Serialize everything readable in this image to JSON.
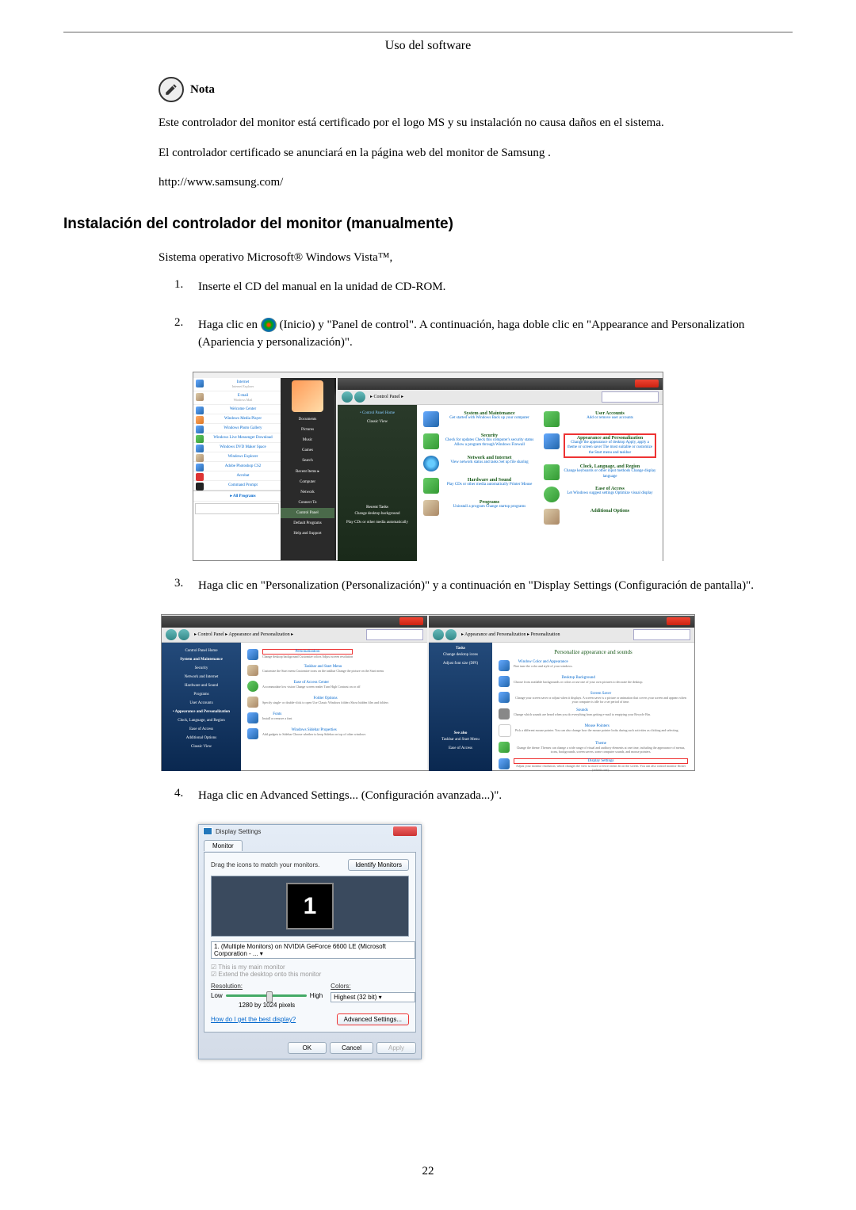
{
  "header": {
    "section_title": "Uso del software"
  },
  "note": {
    "label": "Nota",
    "line1": "Este controlador del monitor está certificado por el logo MS y su instalación no causa daños en el sistema.",
    "line2": "El controlador certificado se anunciará en la página web del monitor de Samsung .",
    "url": "http://www.samsung.com/"
  },
  "heading": "Instalación del controlador del monitor (manualmente)",
  "intro": "Sistema operativo Microsoft® Windows Vista™,",
  "steps": {
    "s1": {
      "num": "1.",
      "text": "Inserte el CD del manual en la unidad de CD-ROM."
    },
    "s2": {
      "num": "2.",
      "pre": "Haga clic en ",
      "mid": "(Inicio) y \"Panel de control\". A continuación, haga doble clic en \"Appearance and Personalization (Apariencia y personalización)\"."
    },
    "s3": {
      "num": "3.",
      "text": "Haga clic en \"Personalization (Personalización)\" y a continuación en \"Display Settings (Configuración de pantalla)\"."
    },
    "s4": {
      "num": "4.",
      "text": "Haga clic en Advanced Settings... (Configuración avanzada...)\"."
    }
  },
  "start_menu": {
    "items": [
      "Internet",
      "E-mail",
      "Welcome Center",
      "Windows Media Player",
      "Windows Photo Gallery",
      "Windows Live Messenger Download",
      "Windows DVD Maker Space",
      "Windows Explorer",
      "Adobe Photoshop CS2",
      "Acrobat"
    ],
    "cmd_prompt": "Command Prompt",
    "all_programs": "All Programs",
    "right": [
      "Documents",
      "Pictures",
      "Music",
      "Games",
      "Search",
      "Recent Items",
      "Computer",
      "Network",
      "Connect To",
      "Control Panel",
      "Default Programs",
      "Help and Support"
    ]
  },
  "control_panel": {
    "breadcrumb": "▸ Control Panel ▸",
    "sidebar1": "Control Panel Home",
    "sidebar2": "Classic View",
    "cats": {
      "system": {
        "title": "System and Maintenance",
        "sub": "Get started with Windows\nBack up your computer"
      },
      "security": {
        "title": "Security",
        "sub": "Check for updates\nCheck this computer's security status\nAllow a program through Windows Firewall"
      },
      "network": {
        "title": "Network and Internet",
        "sub": "View network status and tasks\nSet up file sharing"
      },
      "hardware": {
        "title": "Hardware and Sound",
        "sub": "Play CDs or other media automatically\nPrinter\nMouse"
      },
      "programs": {
        "title": "Programs",
        "sub": "Uninstall a program\nChange startup programs"
      },
      "user": {
        "title": "User Accounts",
        "sub": "Add or remove user accounts"
      },
      "appearance": {
        "title": "Appearance and Personalization",
        "sub": "Change the appearance of desktop\nApply, apply a theme or screen saver\nThe most suitable or customize the Start menu and taskbar"
      },
      "clock": {
        "title": "Clock, Language, and Region",
        "sub": "Change keyboards or other input methods\nChange display language"
      },
      "ease": {
        "title": "Ease of Access",
        "sub": "Let Windows suggest settings\nOptimize visual display"
      },
      "additional": {
        "title": "Additional Options",
        "sub": ""
      }
    },
    "recent_title": "Recent Tasks",
    "recent1": "Change desktop background",
    "recent2": "Play CDs or other media automatically"
  },
  "appearance_panel": {
    "breadcrumb": "▸ Control Panel ▸ Appearance and Personalization ▸",
    "items": {
      "pers": {
        "title": "Personalization",
        "sub": "Change desktop background  Customize colors  Adjust screen resolution"
      },
      "taskbar": {
        "title": "Taskbar and Start Menu",
        "sub": "Customize the Start menu  Customize icons on the taskbar  Change the picture on the Start menu"
      },
      "folder": {
        "title": "Folder Options",
        "sub": "Specify single- or double-click to open  Use Classic Windows folders  Show hidden files and folders"
      },
      "fonts": {
        "title": "Fonts",
        "sub": "Install or remove a font"
      },
      "sidebar": {
        "title": "Windows Sidebar Properties",
        "sub": "Add gadgets to Sidebar  Choose whether to keep Sidebar on top of other windows"
      },
      "ease": {
        "title": "Ease of Access Center",
        "sub": "Accommodate low vision  Change screen reader  Turn High Contrast on or off"
      }
    }
  },
  "personalization_panel": {
    "breadcrumb": "▸ Appearance and Personalization ▸ Personalization",
    "heading": "Personalize appearance and sounds",
    "tasks_label": "Tasks",
    "task1": "Change desktop icons",
    "task2": "Adjust font size (DPI)",
    "items": {
      "wincolor": {
        "title": "Window Color and Appearance",
        "sub": "Fine tune the color and style of your windows."
      },
      "bg": {
        "title": "Desktop Background",
        "sub": "Choose from available backgrounds or colors or use one of your own pictures to decorate the desktop."
      },
      "ss": {
        "title": "Screen Saver",
        "sub": "Change your screen saver or adjust when it displays. A screen saver is a picture or animation that covers your screen and appears when your computer is idle for a set period of time."
      },
      "sounds": {
        "title": "Sounds",
        "sub": "Change which sounds are heard when you do everything from getting e-mail to emptying your Recycle Bin."
      },
      "mouse": {
        "title": "Mouse Pointers",
        "sub": "Pick a different mouse pointer. You can also change how the mouse pointer looks during such activities as clicking and selecting."
      },
      "theme": {
        "title": "Theme",
        "sub": "Change the theme. Themes can change a wide range of visual and auditory elements at one time, including the appearance of menus, icons, backgrounds, screen savers, some computer sounds, and mouse pointers."
      },
      "display": {
        "title": "Display Settings",
        "sub": "Adjust your monitor resolution, which changes the view so more or fewer items fit on the screen. You can also control monitor flicker (refresh rate)."
      }
    },
    "see_also": "See also",
    "see1": "Taskbar and Start Menu",
    "see2": "Ease of Access"
  },
  "display_settings": {
    "title": "Display Settings",
    "tab": "Monitor",
    "instruction": "Drag the icons to match your monitors.",
    "identify_btn": "Identify Monitors",
    "monitor_num": "1",
    "dropdown": "1. (Multiple Monitors) on NVIDIA GeForce 6600 LE (Microsoft Corporation - ...",
    "check1": "This is my main monitor",
    "check2": "Extend the desktop onto this monitor",
    "res_label": "Resolution:",
    "low": "Low",
    "high": "High",
    "resolution": "1280 by 1024 pixels",
    "colors_label": "Colors:",
    "colors_value": "Highest (32 bit)",
    "help_link": "How do I get the best display?",
    "advanced_btn": "Advanced Settings...",
    "ok": "OK",
    "cancel": "Cancel",
    "apply": "Apply"
  },
  "page_number": "22"
}
